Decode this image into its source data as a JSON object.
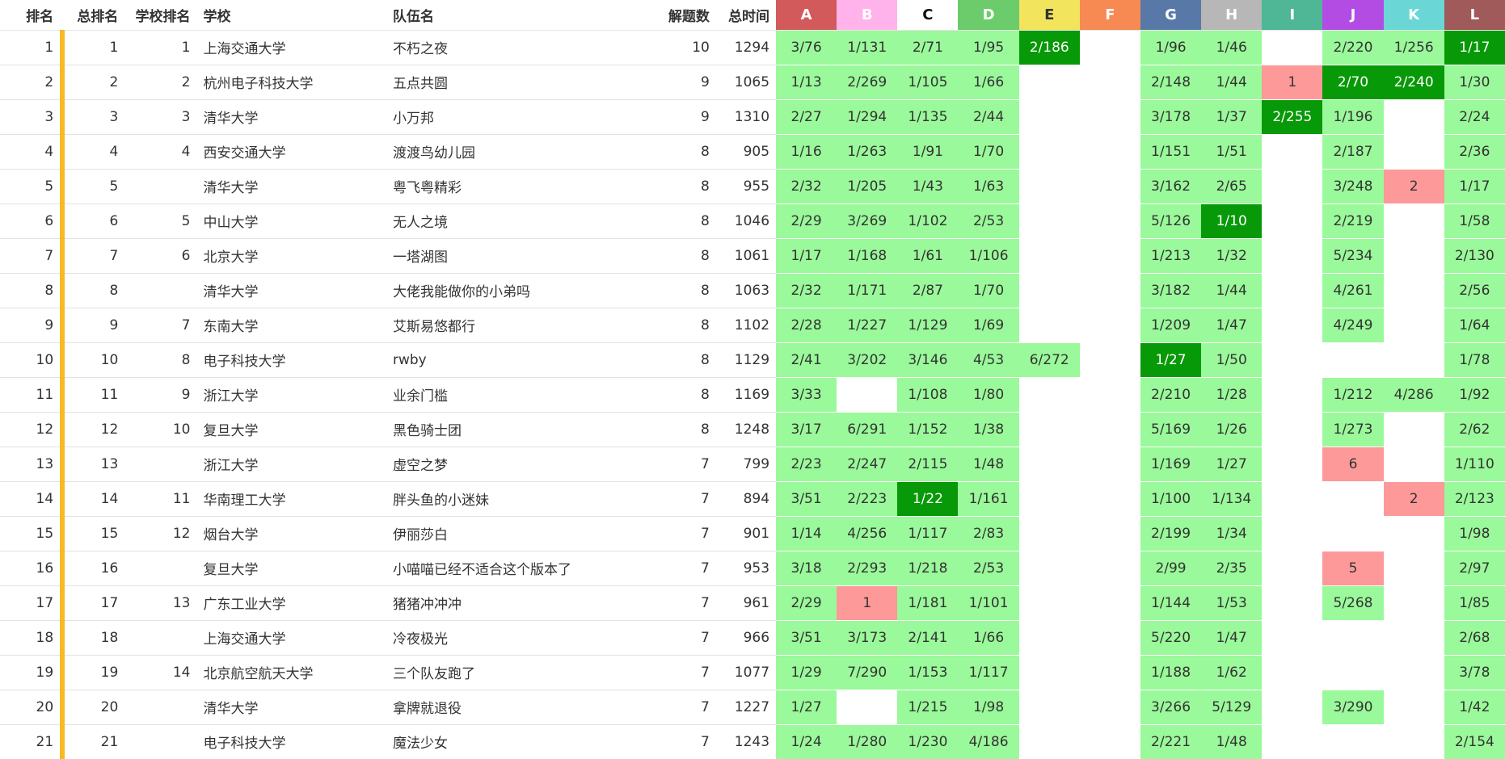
{
  "headers": {
    "rank": "排名",
    "overall_rank": "总排名",
    "school_rank": "学校排名",
    "school": "学校",
    "team": "队伍名",
    "solved": "解题数",
    "penalty": "总时间"
  },
  "problems": [
    {
      "label": "A",
      "color": "#d35a5a",
      "text_color": "#ffffff"
    },
    {
      "label": "B",
      "color": "#ffb3ea",
      "text_color": "#ffffff"
    },
    {
      "label": "C",
      "color": "#ffffff",
      "text_color": "#111111"
    },
    {
      "label": "D",
      "color": "#6ccc6c",
      "text_color": "#ffffff"
    },
    {
      "label": "E",
      "color": "#f2e45d",
      "text_color": "#333333"
    },
    {
      "label": "F",
      "color": "#f68a52",
      "text_color": "#ffffff"
    },
    {
      "label": "G",
      "color": "#5879a8",
      "text_color": "#ffffff"
    },
    {
      "label": "H",
      "color": "#b7b7b7",
      "text_color": "#ffffff"
    },
    {
      "label": "I",
      "color": "#4fb795",
      "text_color": "#ffffff"
    },
    {
      "label": "J",
      "color": "#b34ce3",
      "text_color": "#ffffff"
    },
    {
      "label": "K",
      "color": "#6bd6d6",
      "text_color": "#ffffff"
    },
    {
      "label": "L",
      "color": "#a05a5a",
      "text_color": "#ffffff"
    }
  ],
  "rows": [
    {
      "rank": "1",
      "overall": "1",
      "school_rank": "1",
      "school": "上海交通大学",
      "team": "不朽之夜",
      "solved": "10",
      "penalty": "1294",
      "cells": [
        [
          "s",
          "3/76"
        ],
        [
          "s",
          "1/131"
        ],
        [
          "s",
          "2/71"
        ],
        [
          "s",
          "1/95"
        ],
        [
          "f",
          "2/186"
        ],
        [
          "n",
          ""
        ],
        [
          "s",
          "1/96"
        ],
        [
          "s",
          "1/46"
        ],
        [
          "n",
          ""
        ],
        [
          "s",
          "2/220"
        ],
        [
          "s",
          "1/256"
        ],
        [
          "f",
          "1/17"
        ]
      ]
    },
    {
      "rank": "2",
      "overall": "2",
      "school_rank": "2",
      "school": "杭州电子科技大学",
      "team": "五点共圆",
      "solved": "9",
      "penalty": "1065",
      "cells": [
        [
          "s",
          "1/13"
        ],
        [
          "s",
          "2/269"
        ],
        [
          "s",
          "1/105"
        ],
        [
          "s",
          "1/66"
        ],
        [
          "n",
          ""
        ],
        [
          "n",
          ""
        ],
        [
          "s",
          "2/148"
        ],
        [
          "s",
          "1/44"
        ],
        [
          "x",
          "1"
        ],
        [
          "f",
          "2/70"
        ],
        [
          "f",
          "2/240"
        ],
        [
          "s",
          "1/30"
        ]
      ]
    },
    {
      "rank": "3",
      "overall": "3",
      "school_rank": "3",
      "school": "清华大学",
      "team": "小万邦",
      "solved": "9",
      "penalty": "1310",
      "cells": [
        [
          "s",
          "2/27"
        ],
        [
          "s",
          "1/294"
        ],
        [
          "s",
          "1/135"
        ],
        [
          "s",
          "2/44"
        ],
        [
          "n",
          ""
        ],
        [
          "n",
          ""
        ],
        [
          "s",
          "3/178"
        ],
        [
          "s",
          "1/37"
        ],
        [
          "f",
          "2/255"
        ],
        [
          "s",
          "1/196"
        ],
        [
          "n",
          ""
        ],
        [
          "s",
          "2/24"
        ]
      ]
    },
    {
      "rank": "4",
      "overall": "4",
      "school_rank": "4",
      "school": "西安交通大学",
      "team": "渡渡鸟幼儿园",
      "solved": "8",
      "penalty": "905",
      "cells": [
        [
          "s",
          "1/16"
        ],
        [
          "s",
          "1/263"
        ],
        [
          "s",
          "1/91"
        ],
        [
          "s",
          "1/70"
        ],
        [
          "n",
          ""
        ],
        [
          "n",
          ""
        ],
        [
          "s",
          "1/151"
        ],
        [
          "s",
          "1/51"
        ],
        [
          "n",
          ""
        ],
        [
          "s",
          "2/187"
        ],
        [
          "n",
          ""
        ],
        [
          "s",
          "2/36"
        ]
      ]
    },
    {
      "rank": "5",
      "overall": "5",
      "school_rank": "",
      "school": "清华大学",
      "team": "粤飞粤精彩",
      "solved": "8",
      "penalty": "955",
      "cells": [
        [
          "s",
          "2/32"
        ],
        [
          "s",
          "1/205"
        ],
        [
          "s",
          "1/43"
        ],
        [
          "s",
          "1/63"
        ],
        [
          "n",
          ""
        ],
        [
          "n",
          ""
        ],
        [
          "s",
          "3/162"
        ],
        [
          "s",
          "2/65"
        ],
        [
          "n",
          ""
        ],
        [
          "s",
          "3/248"
        ],
        [
          "x",
          "2"
        ],
        [
          "s",
          "1/17"
        ]
      ]
    },
    {
      "rank": "6",
      "overall": "6",
      "school_rank": "5",
      "school": "中山大学",
      "team": "无人之境",
      "solved": "8",
      "penalty": "1046",
      "cells": [
        [
          "s",
          "2/29"
        ],
        [
          "s",
          "3/269"
        ],
        [
          "s",
          "1/102"
        ],
        [
          "s",
          "2/53"
        ],
        [
          "n",
          ""
        ],
        [
          "n",
          ""
        ],
        [
          "s",
          "5/126"
        ],
        [
          "f",
          "1/10"
        ],
        [
          "n",
          ""
        ],
        [
          "s",
          "2/219"
        ],
        [
          "n",
          ""
        ],
        [
          "s",
          "1/58"
        ]
      ]
    },
    {
      "rank": "7",
      "overall": "7",
      "school_rank": "6",
      "school": "北京大学",
      "team": "一塔湖图",
      "solved": "8",
      "penalty": "1061",
      "cells": [
        [
          "s",
          "1/17"
        ],
        [
          "s",
          "1/168"
        ],
        [
          "s",
          "1/61"
        ],
        [
          "s",
          "1/106"
        ],
        [
          "n",
          ""
        ],
        [
          "n",
          ""
        ],
        [
          "s",
          "1/213"
        ],
        [
          "s",
          "1/32"
        ],
        [
          "n",
          ""
        ],
        [
          "s",
          "5/234"
        ],
        [
          "n",
          ""
        ],
        [
          "s",
          "2/130"
        ]
      ]
    },
    {
      "rank": "8",
      "overall": "8",
      "school_rank": "",
      "school": "清华大学",
      "team": "大佬我能做你的小弟吗",
      "solved": "8",
      "penalty": "1063",
      "cells": [
        [
          "s",
          "2/32"
        ],
        [
          "s",
          "1/171"
        ],
        [
          "s",
          "2/87"
        ],
        [
          "s",
          "1/70"
        ],
        [
          "n",
          ""
        ],
        [
          "n",
          ""
        ],
        [
          "s",
          "3/182"
        ],
        [
          "s",
          "1/44"
        ],
        [
          "n",
          ""
        ],
        [
          "s",
          "4/261"
        ],
        [
          "n",
          ""
        ],
        [
          "s",
          "2/56"
        ]
      ]
    },
    {
      "rank": "9",
      "overall": "9",
      "school_rank": "7",
      "school": "东南大学",
      "team": "艾斯易悠都行",
      "solved": "8",
      "penalty": "1102",
      "cells": [
        [
          "s",
          "2/28"
        ],
        [
          "s",
          "1/227"
        ],
        [
          "s",
          "1/129"
        ],
        [
          "s",
          "1/69"
        ],
        [
          "n",
          ""
        ],
        [
          "n",
          ""
        ],
        [
          "s",
          "1/209"
        ],
        [
          "s",
          "1/47"
        ],
        [
          "n",
          ""
        ],
        [
          "s",
          "4/249"
        ],
        [
          "n",
          ""
        ],
        [
          "s",
          "1/64"
        ]
      ]
    },
    {
      "rank": "10",
      "overall": "10",
      "school_rank": "8",
      "school": "电子科技大学",
      "team": "rwby",
      "solved": "8",
      "penalty": "1129",
      "cells": [
        [
          "s",
          "2/41"
        ],
        [
          "s",
          "3/202"
        ],
        [
          "s",
          "3/146"
        ],
        [
          "s",
          "4/53"
        ],
        [
          "s",
          "6/272"
        ],
        [
          "n",
          ""
        ],
        [
          "f",
          "1/27"
        ],
        [
          "s",
          "1/50"
        ],
        [
          "n",
          ""
        ],
        [
          "n",
          ""
        ],
        [
          "n",
          ""
        ],
        [
          "s",
          "1/78"
        ]
      ]
    },
    {
      "rank": "11",
      "overall": "11",
      "school_rank": "9",
      "school": "浙江大学",
      "team": "业余门槛",
      "solved": "8",
      "penalty": "1169",
      "cells": [
        [
          "s",
          "3/33"
        ],
        [
          "n",
          ""
        ],
        [
          "s",
          "1/108"
        ],
        [
          "s",
          "1/80"
        ],
        [
          "n",
          ""
        ],
        [
          "n",
          ""
        ],
        [
          "s",
          "2/210"
        ],
        [
          "s",
          "1/28"
        ],
        [
          "n",
          ""
        ],
        [
          "s",
          "1/212"
        ],
        [
          "s",
          "4/286"
        ],
        [
          "s",
          "1/92"
        ]
      ]
    },
    {
      "rank": "12",
      "overall": "12",
      "school_rank": "10",
      "school": "复旦大学",
      "team": "黑色骑士团",
      "solved": "8",
      "penalty": "1248",
      "cells": [
        [
          "s",
          "3/17"
        ],
        [
          "s",
          "6/291"
        ],
        [
          "s",
          "1/152"
        ],
        [
          "s",
          "1/38"
        ],
        [
          "n",
          ""
        ],
        [
          "n",
          ""
        ],
        [
          "s",
          "5/169"
        ],
        [
          "s",
          "1/26"
        ],
        [
          "n",
          ""
        ],
        [
          "s",
          "1/273"
        ],
        [
          "n",
          ""
        ],
        [
          "s",
          "2/62"
        ]
      ]
    },
    {
      "rank": "13",
      "overall": "13",
      "school_rank": "",
      "school": "浙江大学",
      "team": "虚空之梦",
      "solved": "7",
      "penalty": "799",
      "cells": [
        [
          "s",
          "2/23"
        ],
        [
          "s",
          "2/247"
        ],
        [
          "s",
          "2/115"
        ],
        [
          "s",
          "1/48"
        ],
        [
          "n",
          ""
        ],
        [
          "n",
          ""
        ],
        [
          "s",
          "1/169"
        ],
        [
          "s",
          "1/27"
        ],
        [
          "n",
          ""
        ],
        [
          "x",
          "6"
        ],
        [
          "n",
          ""
        ],
        [
          "s",
          "1/110"
        ]
      ]
    },
    {
      "rank": "14",
      "overall": "14",
      "school_rank": "11",
      "school": "华南理工大学",
      "team": "胖头鱼的小迷妹",
      "solved": "7",
      "penalty": "894",
      "cells": [
        [
          "s",
          "3/51"
        ],
        [
          "s",
          "2/223"
        ],
        [
          "f",
          "1/22"
        ],
        [
          "s",
          "1/161"
        ],
        [
          "n",
          ""
        ],
        [
          "n",
          ""
        ],
        [
          "s",
          "1/100"
        ],
        [
          "s",
          "1/134"
        ],
        [
          "n",
          ""
        ],
        [
          "n",
          ""
        ],
        [
          "x",
          "2"
        ],
        [
          "s",
          "2/123"
        ]
      ]
    },
    {
      "rank": "15",
      "overall": "15",
      "school_rank": "12",
      "school": "烟台大学",
      "team": "伊丽莎白",
      "solved": "7",
      "penalty": "901",
      "cells": [
        [
          "s",
          "1/14"
        ],
        [
          "s",
          "4/256"
        ],
        [
          "s",
          "1/117"
        ],
        [
          "s",
          "2/83"
        ],
        [
          "n",
          ""
        ],
        [
          "n",
          ""
        ],
        [
          "s",
          "2/199"
        ],
        [
          "s",
          "1/34"
        ],
        [
          "n",
          ""
        ],
        [
          "n",
          ""
        ],
        [
          "n",
          ""
        ],
        [
          "s",
          "1/98"
        ]
      ]
    },
    {
      "rank": "16",
      "overall": "16",
      "school_rank": "",
      "school": "复旦大学",
      "team": "小喵喵已经不适合这个版本了",
      "solved": "7",
      "penalty": "953",
      "cells": [
        [
          "s",
          "3/18"
        ],
        [
          "s",
          "2/293"
        ],
        [
          "s",
          "1/218"
        ],
        [
          "s",
          "2/53"
        ],
        [
          "n",
          ""
        ],
        [
          "n",
          ""
        ],
        [
          "s",
          "2/99"
        ],
        [
          "s",
          "2/35"
        ],
        [
          "n",
          ""
        ],
        [
          "x",
          "5"
        ],
        [
          "n",
          ""
        ],
        [
          "s",
          "2/97"
        ]
      ]
    },
    {
      "rank": "17",
      "overall": "17",
      "school_rank": "13",
      "school": "广东工业大学",
      "team": "猪猪冲冲冲",
      "solved": "7",
      "penalty": "961",
      "cells": [
        [
          "s",
          "2/29"
        ],
        [
          "x",
          "1"
        ],
        [
          "s",
          "1/181"
        ],
        [
          "s",
          "1/101"
        ],
        [
          "n",
          ""
        ],
        [
          "n",
          ""
        ],
        [
          "s",
          "1/144"
        ],
        [
          "s",
          "1/53"
        ],
        [
          "n",
          ""
        ],
        [
          "s",
          "5/268"
        ],
        [
          "n",
          ""
        ],
        [
          "s",
          "1/85"
        ]
      ]
    },
    {
      "rank": "18",
      "overall": "18",
      "school_rank": "",
      "school": "上海交通大学",
      "team": "冷夜极光",
      "solved": "7",
      "penalty": "966",
      "cells": [
        [
          "s",
          "3/51"
        ],
        [
          "s",
          "3/173"
        ],
        [
          "s",
          "2/141"
        ],
        [
          "s",
          "1/66"
        ],
        [
          "n",
          ""
        ],
        [
          "n",
          ""
        ],
        [
          "s",
          "5/220"
        ],
        [
          "s",
          "1/47"
        ],
        [
          "n",
          ""
        ],
        [
          "n",
          ""
        ],
        [
          "n",
          ""
        ],
        [
          "s",
          "2/68"
        ]
      ]
    },
    {
      "rank": "19",
      "overall": "19",
      "school_rank": "14",
      "school": "北京航空航天大学",
      "team": "三个队友跑了",
      "solved": "7",
      "penalty": "1077",
      "cells": [
        [
          "s",
          "1/29"
        ],
        [
          "s",
          "7/290"
        ],
        [
          "s",
          "1/153"
        ],
        [
          "s",
          "1/117"
        ],
        [
          "n",
          ""
        ],
        [
          "n",
          ""
        ],
        [
          "s",
          "1/188"
        ],
        [
          "s",
          "1/62"
        ],
        [
          "n",
          ""
        ],
        [
          "n",
          ""
        ],
        [
          "n",
          ""
        ],
        [
          "s",
          "3/78"
        ]
      ]
    },
    {
      "rank": "20",
      "overall": "20",
      "school_rank": "",
      "school": "清华大学",
      "team": "拿牌就退役",
      "solved": "7",
      "penalty": "1227",
      "cells": [
        [
          "s",
          "1/27"
        ],
        [
          "n",
          ""
        ],
        [
          "s",
          "1/215"
        ],
        [
          "s",
          "1/98"
        ],
        [
          "n",
          ""
        ],
        [
          "n",
          ""
        ],
        [
          "s",
          "3/266"
        ],
        [
          "s",
          "5/129"
        ],
        [
          "n",
          ""
        ],
        [
          "s",
          "3/290"
        ],
        [
          "n",
          ""
        ],
        [
          "s",
          "1/42"
        ]
      ]
    },
    {
      "rank": "21",
      "overall": "21",
      "school_rank": "",
      "school": "电子科技大学",
      "team": "魔法少女",
      "solved": "7",
      "penalty": "1243",
      "cells": [
        [
          "s",
          "1/24"
        ],
        [
          "s",
          "1/280"
        ],
        [
          "s",
          "1/230"
        ],
        [
          "s",
          "4/186"
        ],
        [
          "n",
          ""
        ],
        [
          "n",
          ""
        ],
        [
          "s",
          "2/221"
        ],
        [
          "s",
          "1/48"
        ],
        [
          "n",
          ""
        ],
        [
          "n",
          ""
        ],
        [
          "n",
          ""
        ],
        [
          "s",
          "2/154"
        ]
      ]
    }
  ]
}
